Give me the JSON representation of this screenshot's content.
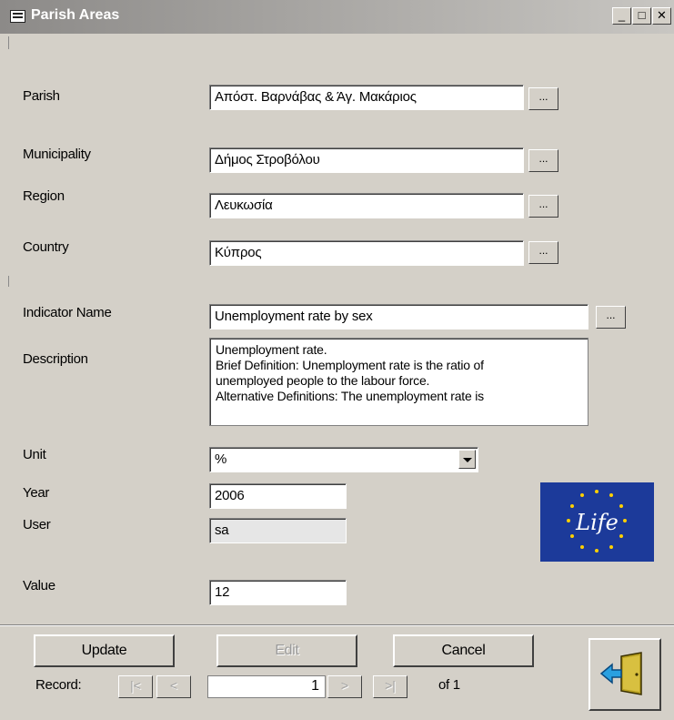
{
  "window": {
    "title": "Parish Areas",
    "minimize": "_",
    "maximize": "□",
    "close": "✕"
  },
  "fields": {
    "parish": {
      "label": "Parish",
      "value": "Απόστ. Βαρνάβας & Άγ. Μακάριος",
      "button": "..."
    },
    "municipality": {
      "label": "Municipality",
      "value": "Δήμος Στροβόλου",
      "button": "..."
    },
    "region": {
      "label": "Region",
      "value": "Λευκωσία",
      "button": "..."
    },
    "country": {
      "label": "Country",
      "value": "Κύπρος",
      "button": "..."
    },
    "indicator": {
      "label": "Indicator Name",
      "value": "Unemployment rate by sex",
      "button": "..."
    },
    "description": {
      "label": "Description",
      "lines": [
        "Unemployment rate.",
        "Brief Definition: Unemployment rate is the ratio of",
        "unemployed people to the labour force.",
        "Alternative Definitions:  The unemployment rate is"
      ]
    },
    "unit": {
      "label": "Unit",
      "value": "%"
    },
    "year": {
      "label": "Year",
      "value": "2006"
    },
    "user": {
      "label": "User",
      "value": "sa"
    },
    "value": {
      "label": "Value",
      "value": "12"
    }
  },
  "logo": {
    "text": "Life",
    "color": "#1c3a9a"
  },
  "buttons": {
    "update": "Update",
    "edit": "Edit",
    "cancel": "Cancel",
    "exit_icon": "exit-door-icon"
  },
  "navigator": {
    "label": "Record:",
    "current": "1",
    "total": "of 1",
    "first": "|<",
    "prev": "<",
    "next": ">",
    "last": ">|"
  }
}
